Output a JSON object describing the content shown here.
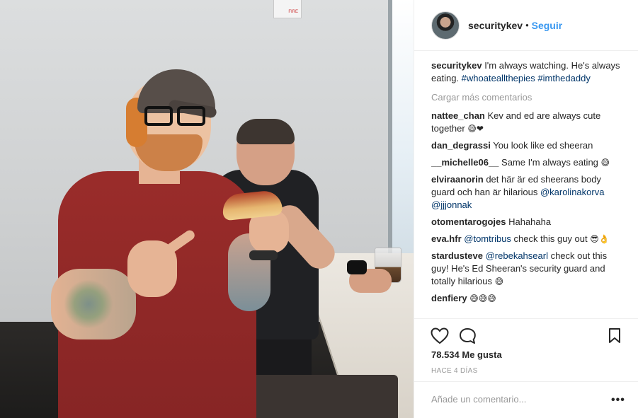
{
  "photo": {
    "alarm_label": "FIRE"
  },
  "header": {
    "username": "securitykev",
    "separator": "•",
    "follow_label": "Seguir"
  },
  "caption": {
    "username": "securitykev",
    "text": "I'm always watching. He's always eating.",
    "hashtags": [
      "#whoateallthepies",
      "#imthedaddy"
    ]
  },
  "load_more_label": "Cargar más comentarios",
  "comments": [
    {
      "user": "nattee_chan",
      "parts": [
        {
          "t": "text",
          "v": "Kev and ed are always cute together "
        },
        {
          "t": "emoji",
          "v": "😅❤"
        }
      ]
    },
    {
      "user": "dan_degrassi",
      "parts": [
        {
          "t": "text",
          "v": "You look like ed sheeran"
        }
      ]
    },
    {
      "user": "__michelle06__",
      "parts": [
        {
          "t": "text",
          "v": "Same I'm always eating "
        },
        {
          "t": "emoji",
          "v": "😅"
        }
      ]
    },
    {
      "user": "elviraanorin",
      "parts": [
        {
          "t": "text",
          "v": "det här är ed sheerans body guard och han är hilarious "
        },
        {
          "t": "tag",
          "v": "@karolinakorva"
        },
        {
          "t": "text",
          "v": " "
        },
        {
          "t": "tag",
          "v": "@jjjonnak"
        }
      ]
    },
    {
      "user": "otomentarogojes",
      "parts": [
        {
          "t": "text",
          "v": "Hahahaha"
        }
      ]
    },
    {
      "user": "eva.hfr",
      "parts": [
        {
          "t": "tag",
          "v": "@tomtribus"
        },
        {
          "t": "text",
          "v": " check this guy out "
        },
        {
          "t": "emoji",
          "v": "😎👌"
        }
      ]
    },
    {
      "user": "stardusteve",
      "parts": [
        {
          "t": "tag",
          "v": "@rebekahsearl"
        },
        {
          "t": "text",
          "v": " check out this guy! He's Ed Sheeran's security guard and totally hilarious "
        },
        {
          "t": "emoji",
          "v": "😅"
        }
      ]
    },
    {
      "user": "denfiery",
      "parts": [
        {
          "t": "emoji",
          "v": "😅😅😅"
        }
      ]
    }
  ],
  "icons": {
    "like": "heart-icon",
    "comment": "comment-icon",
    "save": "bookmark-icon",
    "more": "more-options-icon"
  },
  "likes_label": "78.534 Me gusta",
  "time_label": "HACE 4 DÍAS",
  "add_comment": {
    "placeholder": "Añade un comentario...",
    "more_label": "•••"
  },
  "colors": {
    "link": "#3897f0",
    "tag": "#003569",
    "muted": "#999999",
    "text": "#262626"
  }
}
